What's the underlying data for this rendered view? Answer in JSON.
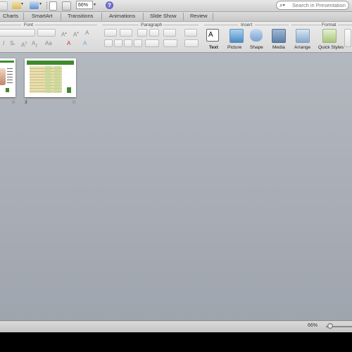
{
  "toolbar": {
    "zoom_value": "66%",
    "search_placeholder": "Search in Presentation",
    "help_label": "?"
  },
  "ribbon_tabs": [
    "Charts",
    "SmartArt",
    "Transitions",
    "Animations",
    "Slide Show",
    "Review"
  ],
  "ribbon_groups": {
    "font": "Font",
    "paragraph": "Paragraph",
    "insert": "Insert",
    "format": "Format"
  },
  "ribbon_buttons": {
    "text": "Text",
    "picture": "Picture",
    "shape": "Shape",
    "media": "Media",
    "arrange": "Arrange",
    "quick_styles": "Quick Styles"
  },
  "slides": [
    {
      "number": "",
      "title": "Slide with diagram"
    },
    {
      "number": "3",
      "title": "Slide with table"
    }
  ],
  "status": {
    "zoom": "66%",
    "zoom_level_percent": 66
  },
  "colors": {
    "slide_header_green": "#3e8a2e",
    "table_tan": "#e9dfb0",
    "canvas_gray": "#a9aeb6"
  }
}
